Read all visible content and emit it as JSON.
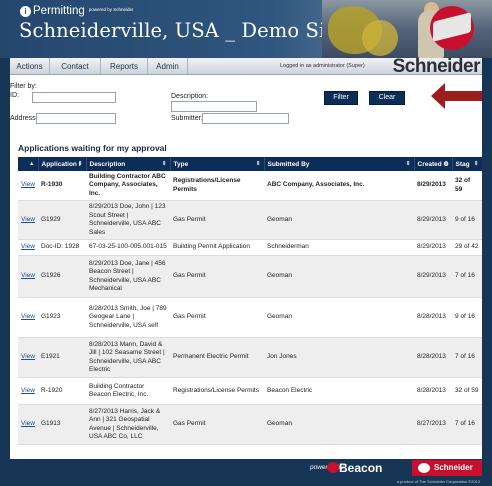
{
  "header": {
    "brand": "Permitting",
    "brand_badge": "i",
    "powered_by": "powered by Schneider",
    "site_title": "Schneiderville, USA _ Demo Site"
  },
  "nav": {
    "items": [
      "Actions",
      "Contact",
      "Reports",
      "Admin"
    ],
    "login_status": "Logged in as administrator (Super)",
    "logo_word": "Schneider"
  },
  "filter": {
    "heading": "Filter by:",
    "id_label": "ID:",
    "id_value": "",
    "description_label": "Description:",
    "description_value": "",
    "address_label": "Address:",
    "address_value": "",
    "submitter_label": "Submitter:",
    "submitter_value": "",
    "filter_button": "Filter",
    "clear_button": "Clear"
  },
  "section": {
    "title": "Applications waiting for my approval"
  },
  "table": {
    "columns": [
      "",
      "Application I",
      "Description",
      "Type",
      "Submitted By",
      "Created O",
      "Stag"
    ],
    "rows": [
      {
        "link": "View",
        "id": "R-1930",
        "description": "Building Contractor ABC Company, Associates, Inc.",
        "type": "Registrations/License Permits",
        "submitted_by": "ABC Company, Associates, Inc.",
        "created": "8/29/2013",
        "stage": "32 of 59",
        "bold": true
      },
      {
        "link": "View",
        "id": "G1929",
        "description": "8/29/2013 Doe, John | 123 Scout Street | Schneiderville, USA ABC Sales",
        "type": "Gas Permit",
        "submitted_by": "Geoman",
        "created": "8/29/2013",
        "stage": "9 of 16",
        "bold": false
      },
      {
        "link": "View",
        "id": "Doc-ID: 1928",
        "description": "67-03-25-100-005.001-015",
        "type": "Building Permit Application",
        "submitted_by": "Schneiderman",
        "created": "8/29/2013",
        "stage": "29 of 42",
        "bold": false
      },
      {
        "link": "View",
        "id": "G1926",
        "description": "8/29/2013 Doe, Jane | 456 Beacon Street | Schneiderville, USA ABC Mechanical",
        "type": "Gas Permit",
        "submitted_by": "Geoman",
        "created": "8/29/2013",
        "stage": "7 of 16",
        "bold": false
      },
      {
        "link": "View",
        "id": "G1923",
        "description": "8/28/2013 Smith, Joe | 789 Geogear Lane | Schneiderville, USA self",
        "type": "Gas Permit",
        "submitted_by": "Geoman",
        "created": "8/28/2013",
        "stage": "9 of 16",
        "bold": false
      },
      {
        "link": "View",
        "id": "E1921",
        "description": "8/28/2013 Mann, David & Jill | 102 Seasame Street | Schneiderville, USA ABC Electric",
        "type": "Permanent Electric Permit",
        "submitted_by": "Jon Jones",
        "created": "8/28/2013",
        "stage": "7 of 16",
        "bold": false
      },
      {
        "link": "View",
        "id": "R-1920",
        "description": "Building Contractor Beacon Electric, Inc.",
        "type": "Registrations/License Permits",
        "submitted_by": "Beacon Electric",
        "created": "8/28/2013",
        "stage": "32 of 59",
        "bold": false
      },
      {
        "link": "View",
        "id": "G1913",
        "description": "8/27/2013 Harris, Jack & Ann | 321 Geospatial Avenue | Schneiderville, USA ABC Co, LLC",
        "type": "Gas Permit",
        "submitted_by": "Geoman",
        "created": "8/27/2013",
        "stage": "7 of 16",
        "bold": false
      }
    ]
  },
  "footer": {
    "powered_by": "powered by",
    "beacon": "Beacon",
    "logo_word": "Schneider",
    "copyright": "a product of The Schneider Corporation ©2013"
  },
  "colors": {
    "header_bg": "#24476e",
    "table_header": "#0c2d57",
    "accent_red": "#c8102e",
    "link": "#1a4fa0"
  },
  "icons": {
    "brand": "permitting-logo-icon",
    "sort": "sort-arrows-icon",
    "arrow": "red-pointer-arrow-icon"
  }
}
